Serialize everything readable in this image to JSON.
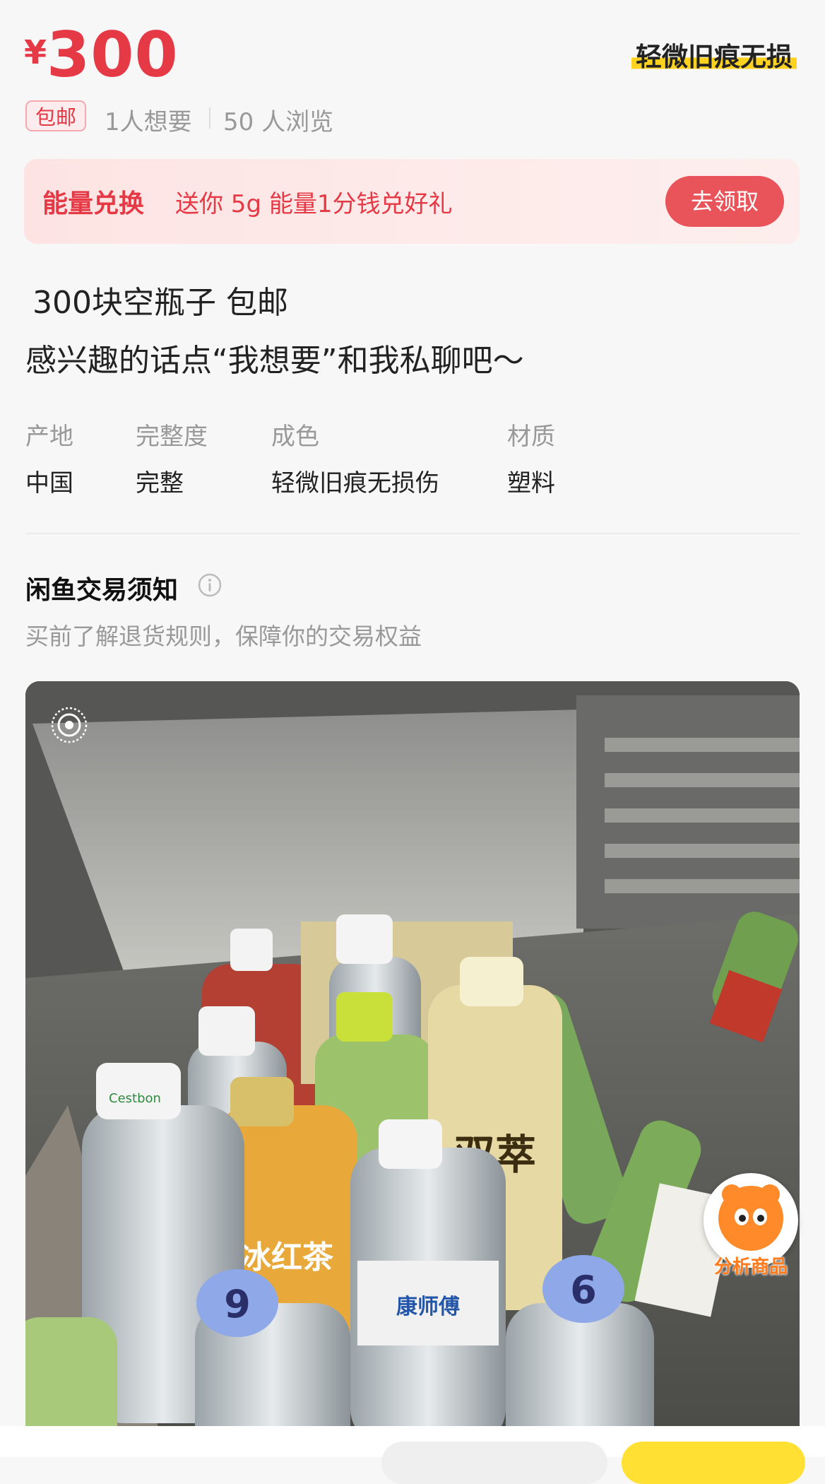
{
  "price": {
    "currency": "¥",
    "amount": "300"
  },
  "condition_tag": "轻微旧痕无损",
  "stats": {
    "badge": "包邮",
    "wants": "1人想要",
    "views": "50 人浏览"
  },
  "banner": {
    "title": "能量兑换",
    "text": "送你 5g 能量1分钱兑好礼",
    "button": "去领取"
  },
  "description": {
    "line1": "300块空瓶子 包邮",
    "line2": "感兴趣的话点“我想要”和我私聊吧～"
  },
  "attributes": [
    {
      "label": "产地",
      "value": "中国"
    },
    {
      "label": "完整度",
      "value": "完整"
    },
    {
      "label": "成色",
      "value": "轻微旧痕无损伤"
    },
    {
      "label": "材质",
      "value": "塑料"
    }
  ],
  "notice": {
    "title": "闲鱼交易须知",
    "subtitle": "买前了解退货规则，保障你的交易权益"
  },
  "photo": {
    "bottle_labels": [
      "双萃",
      "冰红茶",
      "Cestbon",
      "康师傅",
      "6",
      "9"
    ]
  },
  "ai_button": {
    "label": "分析商品"
  },
  "colors": {
    "accent": "#e63946",
    "highlight": "#ffd21f",
    "ai_orange": "#ff7a1a"
  }
}
